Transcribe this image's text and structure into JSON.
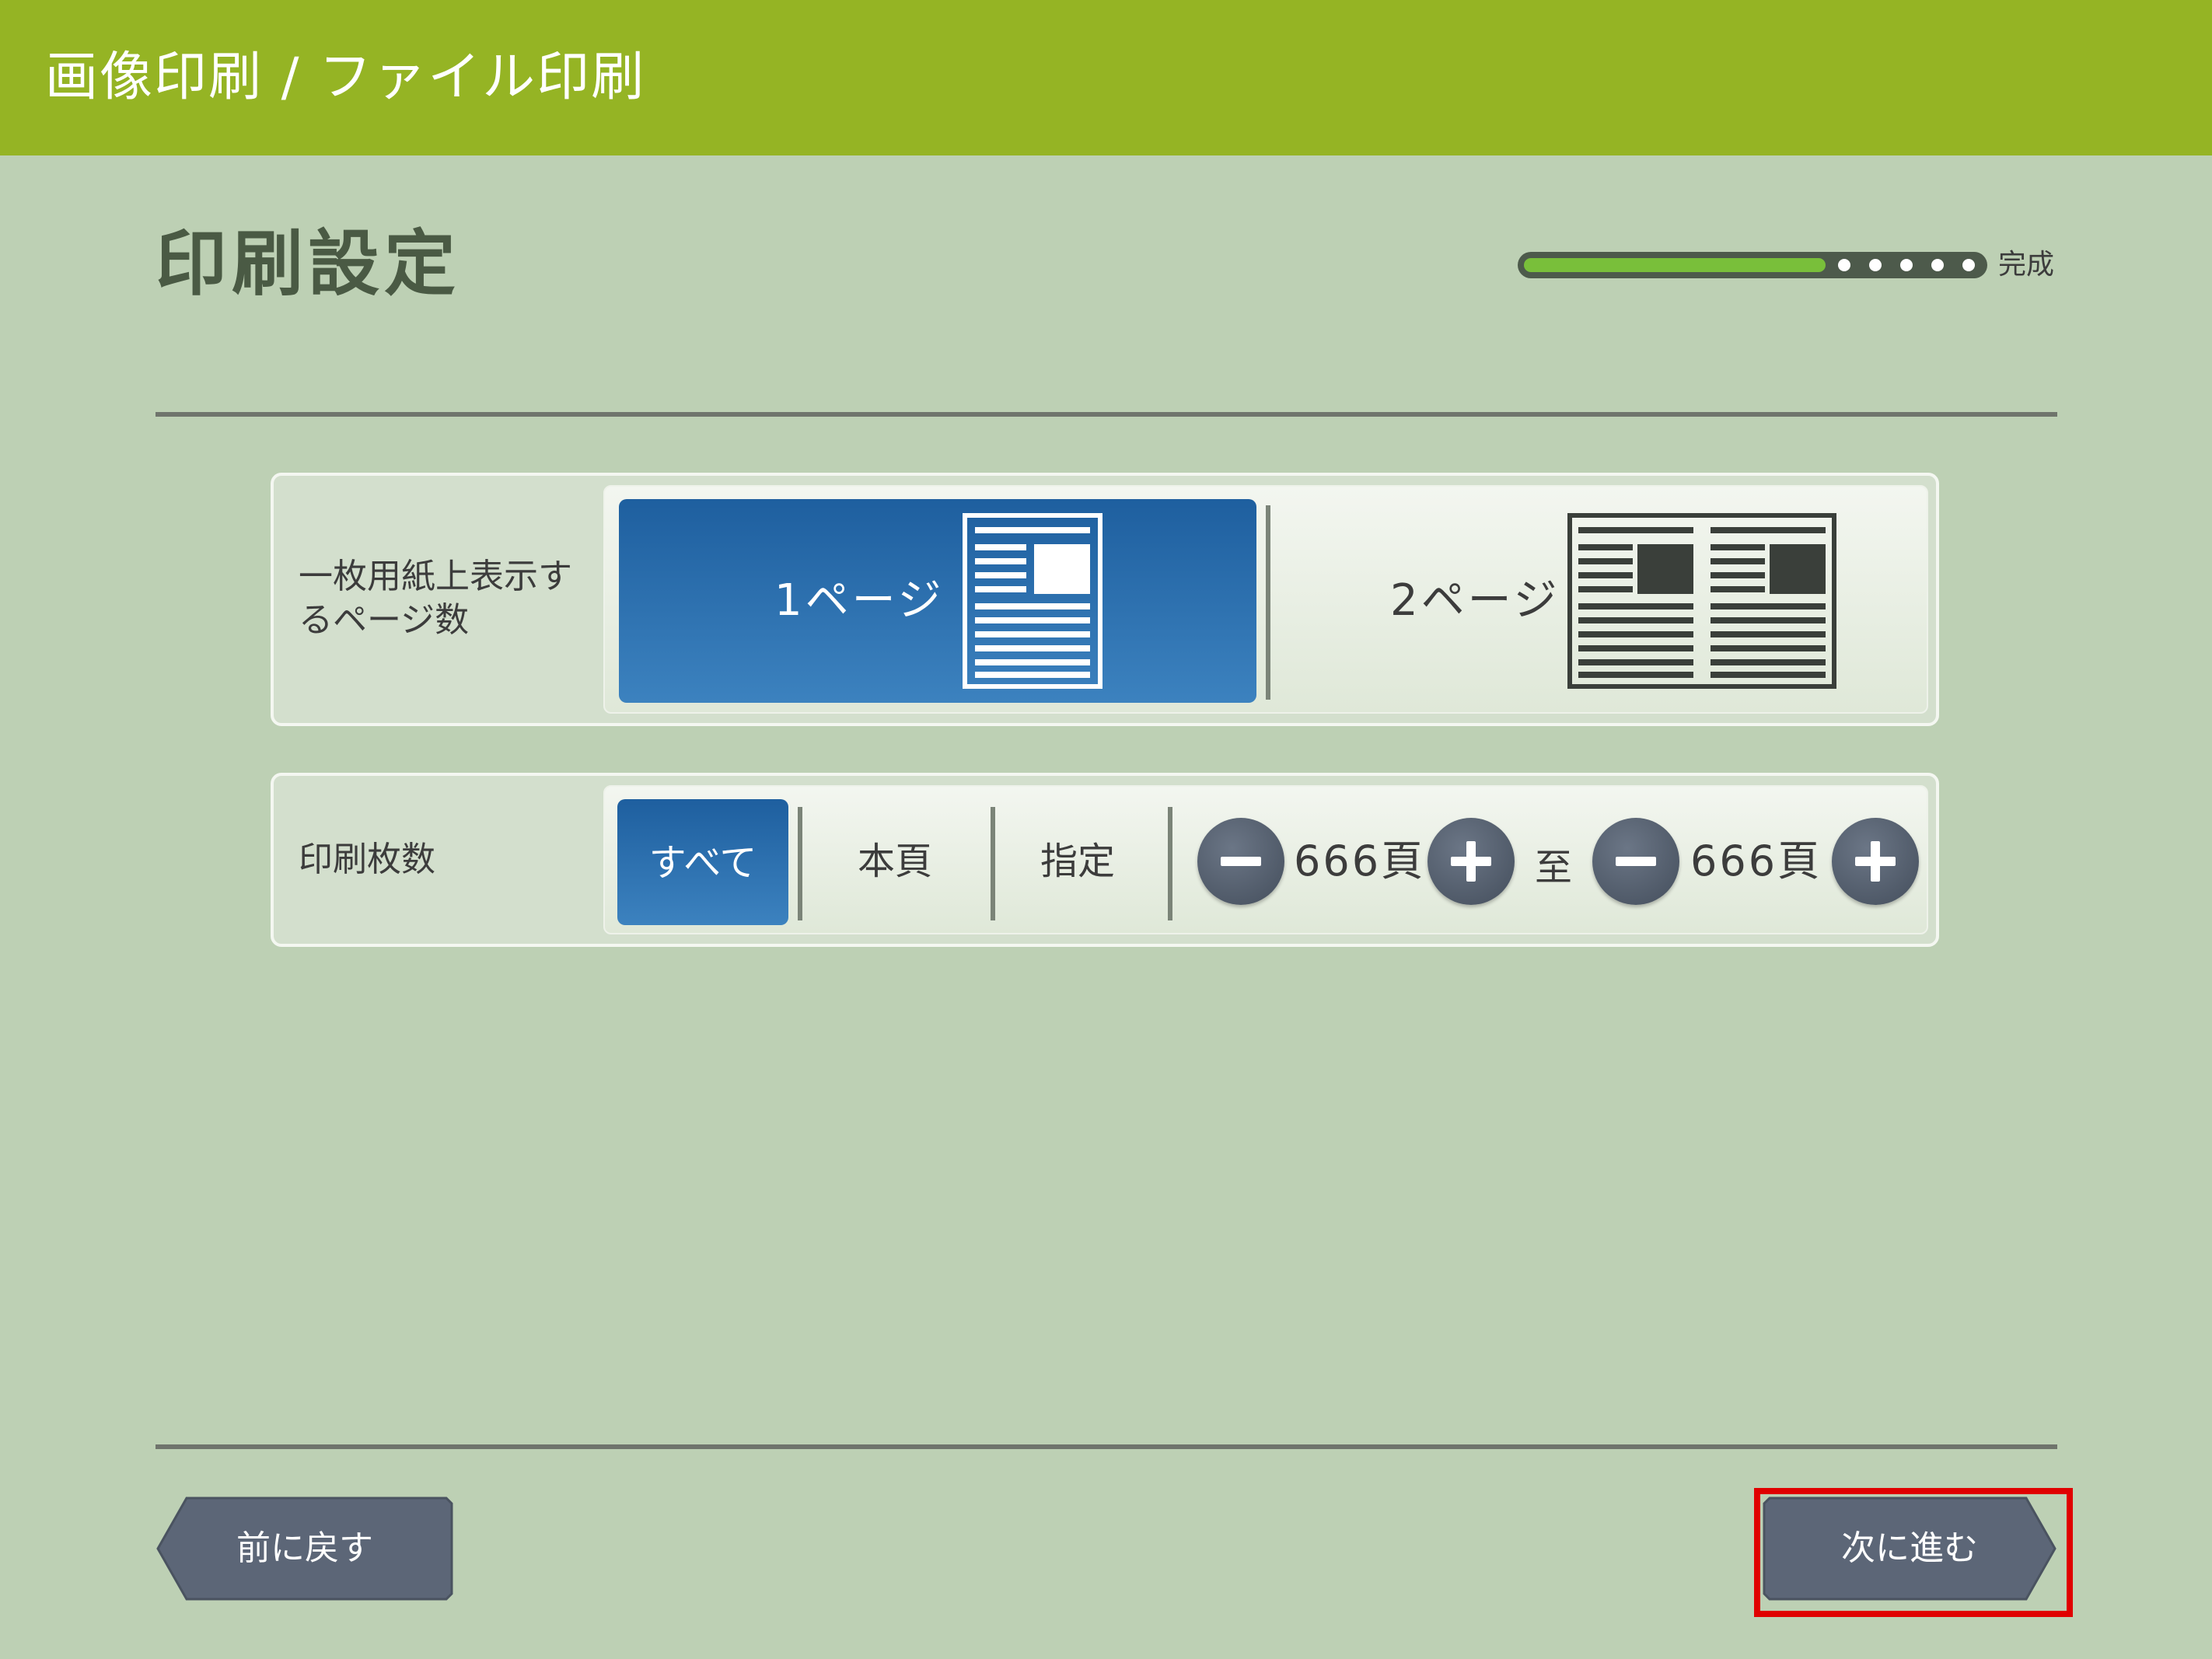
{
  "header": {
    "title": "画像印刷 / ファイル印刷"
  },
  "page": {
    "title": "印刷設定"
  },
  "progress": {
    "completed_steps": 5,
    "remaining_steps": 5,
    "end_label": "完成"
  },
  "pages_per_sheet": {
    "label": "一枚用紙上表示するページ数",
    "options": [
      {
        "label": "1ページ",
        "selected": true
      },
      {
        "label": "2ページ",
        "selected": false
      }
    ]
  },
  "print_range": {
    "label": "印刷枚数",
    "options": [
      {
        "label": "すべて",
        "selected": true
      },
      {
        "label": "本頁",
        "selected": false
      },
      {
        "label": "指定",
        "selected": false
      }
    ],
    "from_value": "666頁",
    "to_label": "至",
    "to_value": "666頁"
  },
  "footer": {
    "back_label": "前に戻す",
    "next_label": "次に進む"
  },
  "colors": {
    "header_bg": "#95b424",
    "page_bg": "#bdd0b4",
    "selected_blue": "#2e73b3",
    "button_dark": "#5b6678",
    "highlight": "#e00000"
  }
}
